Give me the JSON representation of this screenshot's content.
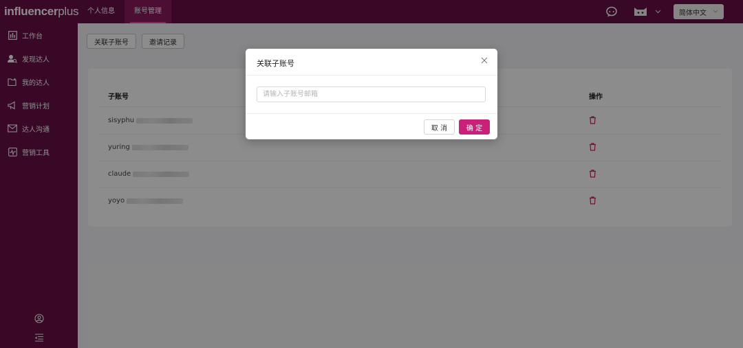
{
  "brand": {
    "bold": "influencer",
    "light": "plus"
  },
  "topnav": {
    "tabs": [
      {
        "label": "个人信息"
      },
      {
        "label": "账号管理"
      }
    ]
  },
  "header": {
    "language": "简体中文"
  },
  "sidebar": {
    "items": [
      {
        "label": "工作台"
      },
      {
        "label": "发现达人"
      },
      {
        "label": "我的达人"
      },
      {
        "label": "营销计划"
      },
      {
        "label": "达人沟通"
      },
      {
        "label": "营销工具"
      }
    ]
  },
  "toolbar": {
    "link_sub_account": "关联子账号",
    "invite_records": "邀请记录"
  },
  "table": {
    "columns": [
      "子账号",
      "操作"
    ],
    "rows": [
      {
        "account": "sisyphu"
      },
      {
        "account": "yuring"
      },
      {
        "account": "claude"
      },
      {
        "account": "yoyo"
      }
    ]
  },
  "modal": {
    "title": "关联子账号",
    "input_placeholder": "请输入子账号邮箱",
    "cancel": "取 消",
    "confirm": "确 定"
  },
  "colors": {
    "brand": "#6b0f47",
    "accent": "#c9207a",
    "delete": "#c0245f"
  }
}
